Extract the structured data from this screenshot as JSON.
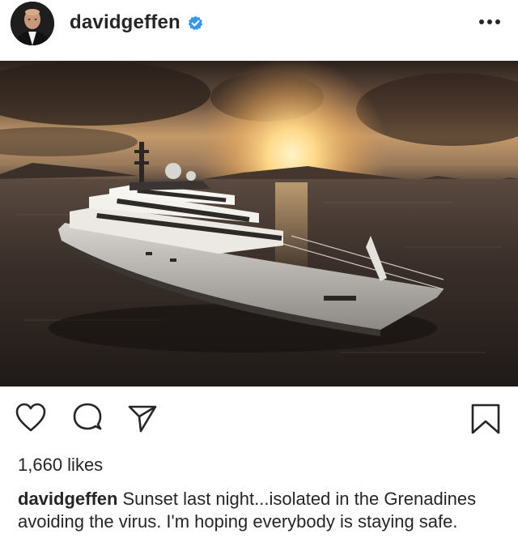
{
  "post": {
    "username": "davidgeffen",
    "verified": true,
    "more_icon": "more-horizontal-icon",
    "photo_subject": "yacht-at-sunset",
    "likes_text": "1,660 likes",
    "caption_text": "Sunset last night...isolated in the Grenadines avoiding the virus.  I'm hoping everybody is staying safe."
  },
  "actions": {
    "like_icon": "heart-icon",
    "comment_icon": "comment-icon",
    "share_icon": "send-icon",
    "save_icon": "bookmark-icon"
  },
  "colors": {
    "text": "#262626",
    "verified_blue": "#3897f0",
    "background": "#ffffff"
  }
}
